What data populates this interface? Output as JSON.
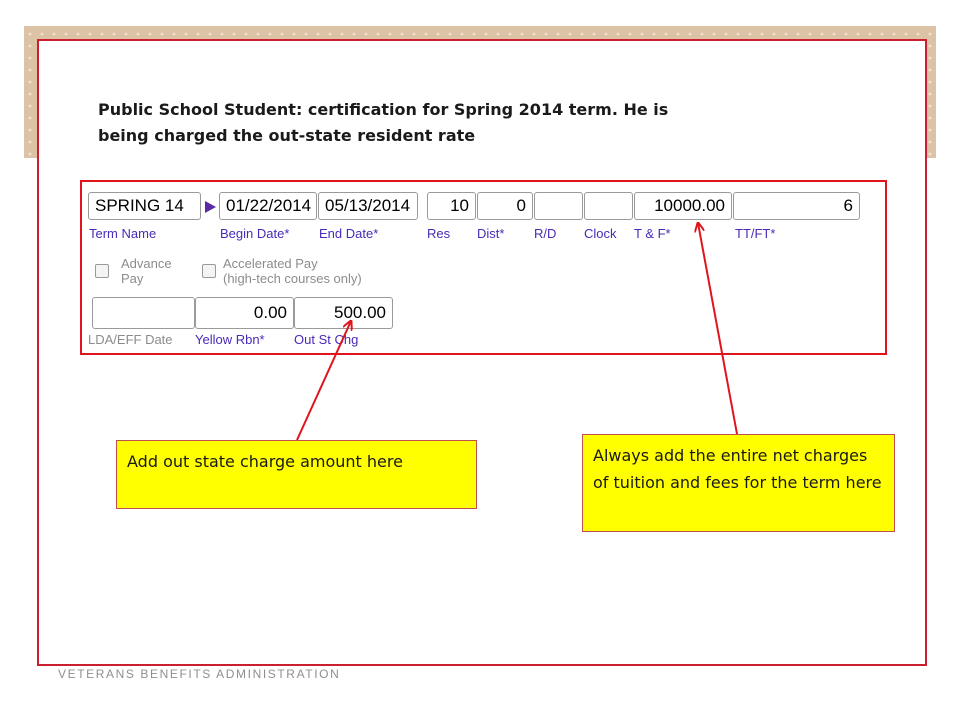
{
  "heading": {
    "line1": "Public School Student:  certification for Spring 2014 term.  He is",
    "line2": "being charged the out-state resident rate"
  },
  "form": {
    "term_name": {
      "value": "SPRING 14",
      "label": "Term Name"
    },
    "begin_date": {
      "value": "01/22/2014",
      "label": "Begin Date*"
    },
    "end_date": {
      "value": "05/13/2014",
      "label": "End Date*"
    },
    "res": {
      "value": "10",
      "label": "Res"
    },
    "dist": {
      "value": "0",
      "label": "Dist*"
    },
    "rd": {
      "value": "",
      "label": "R/D"
    },
    "clock": {
      "value": "",
      "label": "Clock"
    },
    "tf": {
      "value": "10000.00",
      "label": "T & F*"
    },
    "ttft": {
      "value": "6",
      "label": "TT/FT*"
    },
    "advance_pay": {
      "line1": "Advance",
      "line2": "Pay",
      "checked": false
    },
    "accelerated_pay": {
      "line1": "Accelerated Pay",
      "line2": "(high-tech courses only)",
      "checked": false
    },
    "lda_eff": {
      "value": "",
      "label": "LDA/EFF Date"
    },
    "yellow_rbn": {
      "value": "0.00",
      "label": "Yellow Rbn*"
    },
    "out_st_chg": {
      "value": "500.00",
      "label": "Out St Chg"
    }
  },
  "callouts": {
    "left": "Add out state charge amount here",
    "right": "Always add the entire net charges of tuition and fees for the term here"
  },
  "footer": "VETERANS BENEFITS ADMINISTRATION",
  "colors": {
    "frame_border": "#cc1e2e",
    "required_label": "#4a2ab8",
    "callout_fill": "#ffff00",
    "arrow": "#e0141c",
    "play_marker": "#5b2aa6"
  },
  "icons": {
    "term_marker": "play-triangle-icon"
  }
}
